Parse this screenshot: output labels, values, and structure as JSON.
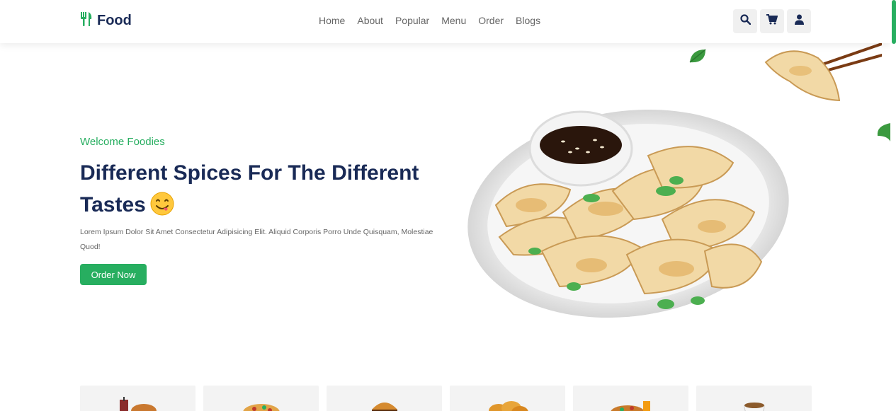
{
  "brand": {
    "name": "Food",
    "accent": "#27ae60",
    "dark": "#192a56"
  },
  "nav": {
    "items": [
      "Home",
      "About",
      "Popular",
      "Menu",
      "Order",
      "Blogs"
    ]
  },
  "header_icons": [
    "search-icon",
    "cart-icon",
    "user-icon"
  ],
  "hero": {
    "subtitle": "Welcome Foodies",
    "title": "Different Spices For The Different Tastes",
    "emoji": "😋",
    "description": "Lorem Ipsum Dolor Sit Amet Consectetur Adipisicing Elit. Aliquid Corporis Porro Unde Quisquam, Molestiae Quod!",
    "button_label": "Order Now"
  },
  "categories": [
    "drink-burger",
    "pizza",
    "burger",
    "fried-chicken",
    "noodles",
    "coffee"
  ]
}
